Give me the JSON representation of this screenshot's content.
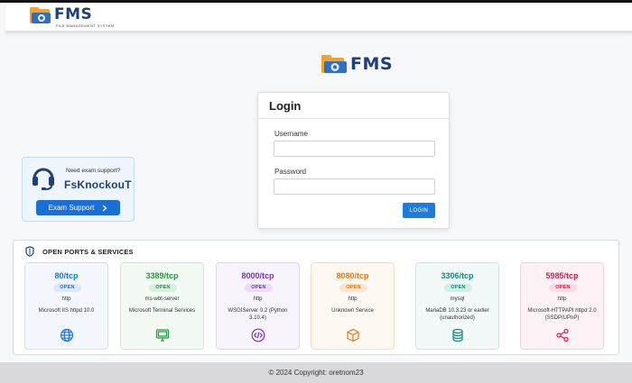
{
  "header": {
    "brand_name": "FMS",
    "brand_subtitle": "FILE MANAGEMENT SYSTEM"
  },
  "center_logo": {
    "brand_name": "FMS"
  },
  "login": {
    "title": "Login",
    "username_label": "Username",
    "username_value": "",
    "password_label": "Password",
    "password_value": "",
    "submit_label": "LOGIN"
  },
  "support": {
    "prompt": "Need exam support?",
    "name": "FsKnockouT",
    "button_label": "Exam Support",
    "button_icon": "chevron-right-icon"
  },
  "ports": {
    "title": "OPEN PORTS & SERVICES",
    "items": [
      {
        "port": "80/tcp",
        "status": "OPEN",
        "protocol": "http",
        "service": "Microsoft IIS httpd 10.0",
        "icon": "globe-icon",
        "color": "#1a73e8",
        "bg": "#f4f8fe",
        "border": "#cfe0f7",
        "badge_bg": "#dbe9fb"
      },
      {
        "port": "3389/tcp",
        "status": "OPEN",
        "protocol": "ms-wbt-server",
        "service": "Microsoft Terminal Services",
        "icon": "monitor-icon",
        "color": "#1e9a3e",
        "bg": "#f3faf4",
        "border": "#cde9d3",
        "badge_bg": "#d8f0de"
      },
      {
        "port": "8000/tcp",
        "status": "OPEN",
        "protocol": "http",
        "service": "WSGIServer 0.2 (Python 3.10.4)",
        "icon": "code-icon",
        "color": "#7b2fbe",
        "bg": "#f8f4fc",
        "border": "#e2d4f2",
        "badge_bg": "#ebdcf7"
      },
      {
        "port": "8080/tcp",
        "status": "OPEN",
        "protocol": "http",
        "service": "Unknown Service",
        "icon": "box-icon",
        "color": "#e8770f",
        "bg": "#fef8f2",
        "border": "#f6dcc3",
        "badge_bg": "#fbe5cf"
      },
      {
        "port": "3306/tcp",
        "status": "OPEN",
        "protocol": "mysql",
        "service": "MariaDB 10.3.23 or earlier (unauthorized)",
        "icon": "database-icon",
        "color": "#138a7a",
        "bg": "#f2f9f8",
        "border": "#cbe6e1",
        "badge_bg": "#d4efe9"
      },
      {
        "port": "5985/tcp",
        "status": "OPEN",
        "protocol": "http",
        "service": "Microsoft-HTTPAPI httpd 2.0 (SSDP/UPnP)",
        "icon": "share-icon",
        "color": "#d81b4f",
        "bg": "#fdf3f6",
        "border": "#f4d2dc",
        "badge_bg": "#f9dbe4"
      }
    ]
  },
  "footer": {
    "copyright": "© 2024 Copyright: oretnom23"
  }
}
